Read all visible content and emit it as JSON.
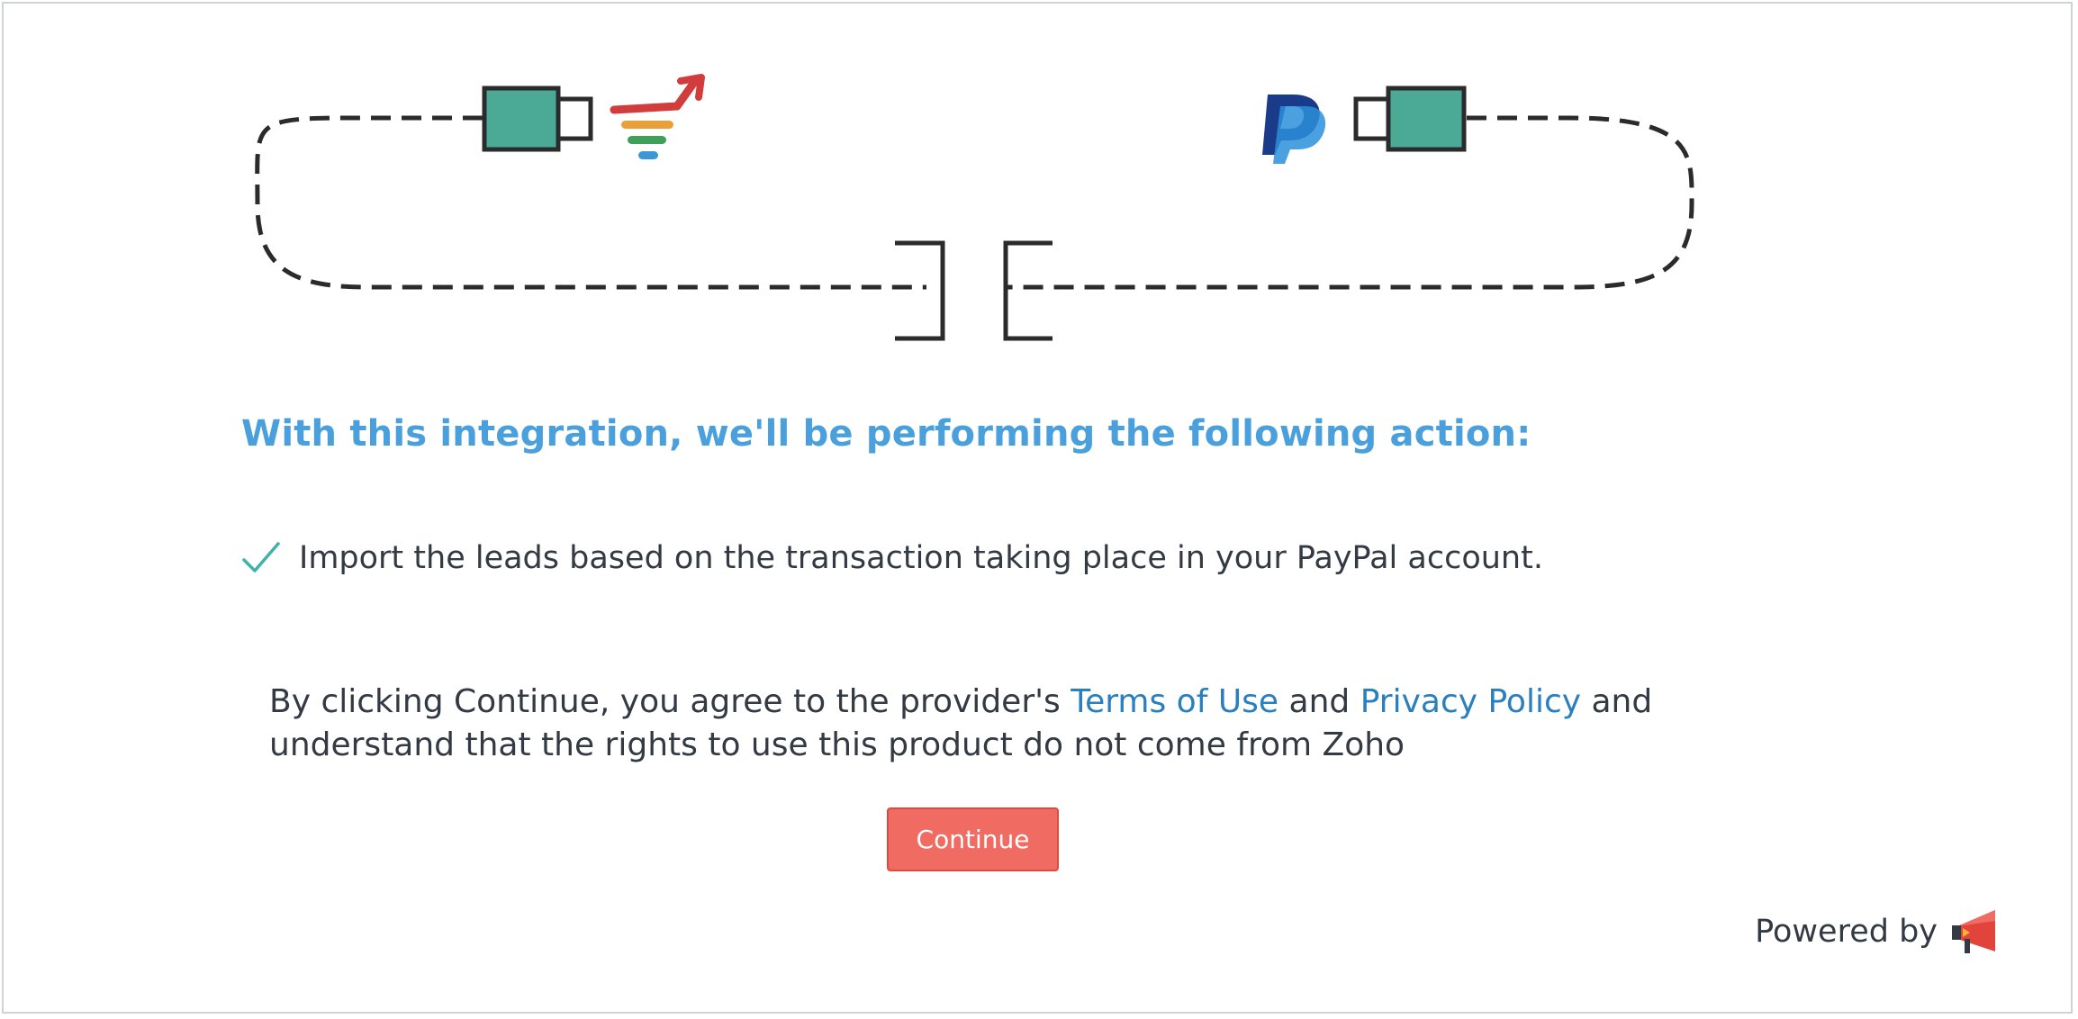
{
  "heading": "With this integration, we'll be performing the following action:",
  "actions": [
    "Import the leads based on the transaction taking place in your PayPal account."
  ],
  "agreement": {
    "prefix": "By clicking Continue, you agree to the provider's ",
    "terms_link": "Terms of Use",
    "middle": " and ",
    "privacy_link": "Privacy Policy",
    "suffix": " and understand that the rights to use this product do not come from Zoho"
  },
  "continue_label": "Continue",
  "powered_by_label": "Powered by",
  "colors": {
    "heading": "#4aa0dc",
    "link": "#2a7fbf",
    "button": "#f06b62",
    "connector": "#4aaa96",
    "check": "#3fb3a8"
  },
  "icons": {
    "left_app": "funnel-arrow-icon",
    "right_app": "paypal-icon",
    "footer": "megaphone-icon"
  }
}
